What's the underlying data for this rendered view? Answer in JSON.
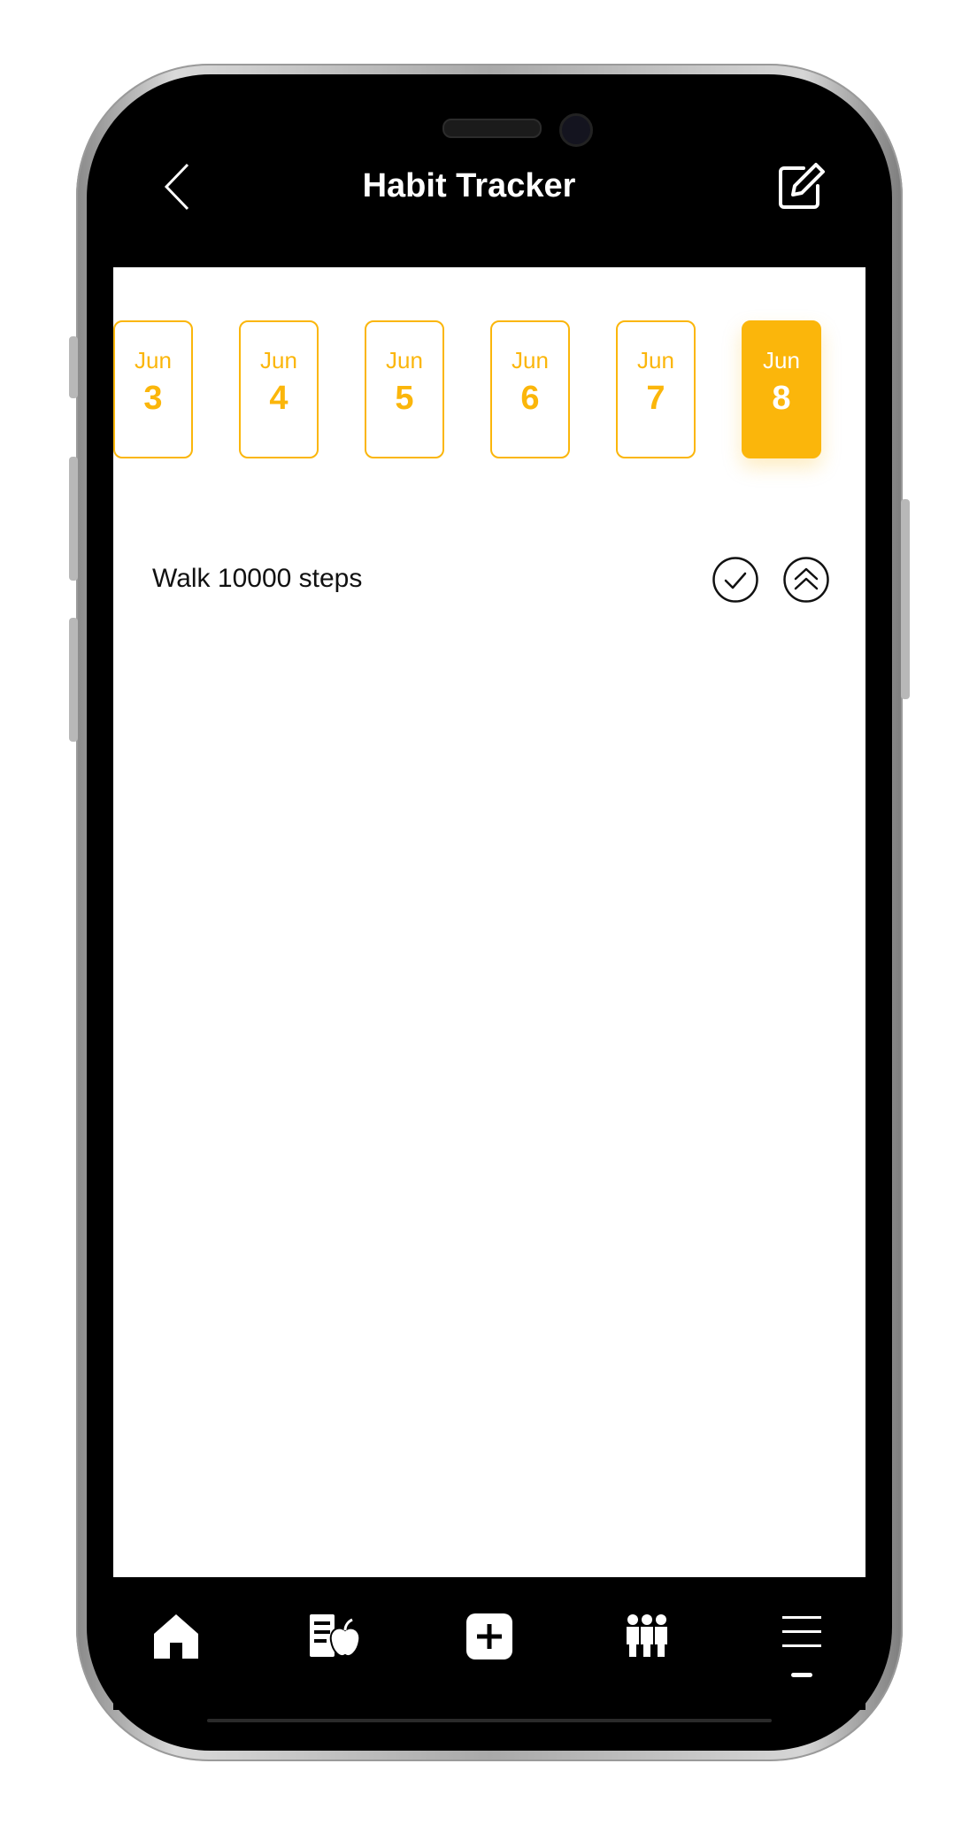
{
  "header": {
    "title": "Habit Tracker",
    "back_icon": "chevron-left-icon",
    "edit_icon": "edit-icon"
  },
  "dates": [
    {
      "month": "Jun",
      "day": "3",
      "selected": false
    },
    {
      "month": "Jun",
      "day": "4",
      "selected": false
    },
    {
      "month": "Jun",
      "day": "5",
      "selected": false
    },
    {
      "month": "Jun",
      "day": "6",
      "selected": false
    },
    {
      "month": "Jun",
      "day": "7",
      "selected": false
    },
    {
      "month": "Jun",
      "day": "8",
      "selected": true
    }
  ],
  "habits": [
    {
      "label": "Walk 10000 steps",
      "actions": [
        "check-circle-icon",
        "double-chevron-up-icon"
      ]
    }
  ],
  "bottom_nav": {
    "items": [
      "home-icon",
      "nutrition-icon",
      "add-icon",
      "community-icon",
      "menu-icon"
    ]
  },
  "colors": {
    "accent": "#fbb60b",
    "background": "#ffffff",
    "bar": "#000000"
  }
}
